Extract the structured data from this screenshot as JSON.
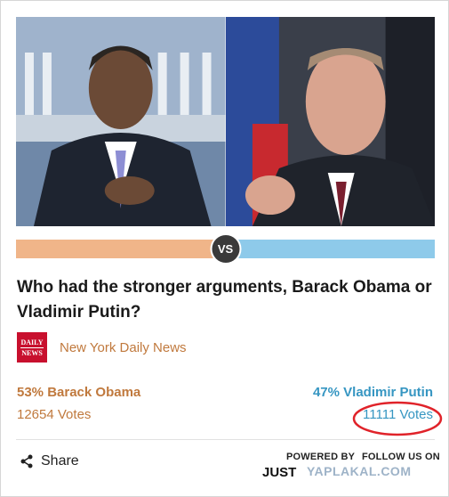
{
  "poll": {
    "question": "Who had the stronger arguments, Barack Obama or Vladimir Putin?",
    "vs_label": "VS",
    "colors": {
      "left": "#f0b589",
      "right": "#8ecaea",
      "left_text": "#c0793d",
      "right_text": "#3696c2"
    },
    "left": {
      "share": 0.53,
      "percent_label": "53% Barack Obama",
      "votes_label": "12654 Votes"
    },
    "right": {
      "share": 0.47,
      "percent_label": "47% Vladimir Putin",
      "votes_label": "11111 Votes"
    }
  },
  "source": {
    "logo_line1": "DAILY",
    "logo_line2": "NEWS",
    "name": "New York Daily News"
  },
  "footer": {
    "share_label": "Share",
    "powered_by": "POWERED BY",
    "follow_us": "FOLLOW US ON",
    "brand": "JUST",
    "watermark": "YAPLAKAL.COM"
  }
}
